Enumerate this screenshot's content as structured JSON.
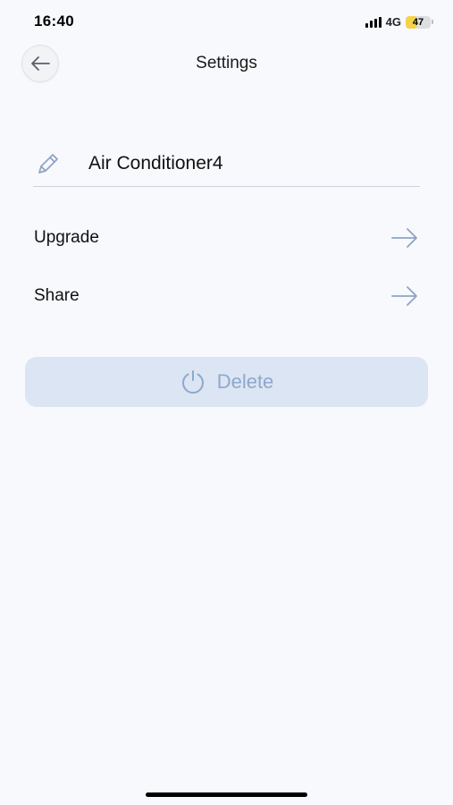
{
  "status_bar": {
    "time": "16:40",
    "network": "4G",
    "battery": {
      "label": "47",
      "level": 0.47,
      "color": "#f4d24b"
    }
  },
  "nav": {
    "title": "Settings",
    "back_icon": "arrow-left-icon"
  },
  "device": {
    "name": "Air Conditioner4",
    "edit_icon": "pencil-icon"
  },
  "menu": {
    "items": [
      {
        "label": "Upgrade",
        "icon": "arrow-right-icon"
      },
      {
        "label": "Share",
        "icon": "arrow-right-icon"
      }
    ]
  },
  "delete": {
    "label": "Delete",
    "icon": "power-icon"
  },
  "colors": {
    "background": "#f7f9fd",
    "accent": "#8fa8cc",
    "delete_bg": "#dbe5f3",
    "divider": "#cdd3de"
  }
}
